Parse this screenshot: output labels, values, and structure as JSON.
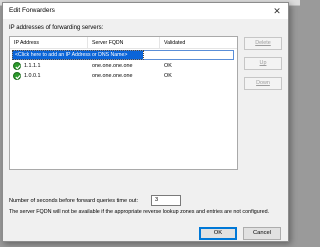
{
  "dialog": {
    "title": "Edit Forwarders",
    "close_glyph": "✕"
  },
  "servers_label": "IP addresses of forwarding servers:",
  "table": {
    "columns": [
      "IP Address",
      "Server FQDN",
      "Validated"
    ],
    "add_placeholder": "<Click here to add an IP Address or DNS Name>",
    "rows": [
      {
        "ip": "1.1.1.1",
        "fqdn": "one.one.one.one",
        "validated": "OK",
        "icon": "check-circle-icon"
      },
      {
        "ip": "1.0.0.1",
        "fqdn": "one.one.one.one",
        "validated": "OK",
        "icon": "check-circle-icon"
      }
    ]
  },
  "side_buttons": {
    "delete": "Delete",
    "up": "Up",
    "down": "Down"
  },
  "timeout": {
    "label": "Number of seconds before forward queries time out:",
    "value": "3"
  },
  "note": "The server FQDN will not be available if the appropriate reverse lookup zones and entries are not configured.",
  "buttons": {
    "ok": "OK",
    "cancel": "Cancel"
  },
  "colors": {
    "selection": "#0a64d8",
    "ok_icon": "#2c9a2c",
    "default_button_border": "#0078d7"
  }
}
